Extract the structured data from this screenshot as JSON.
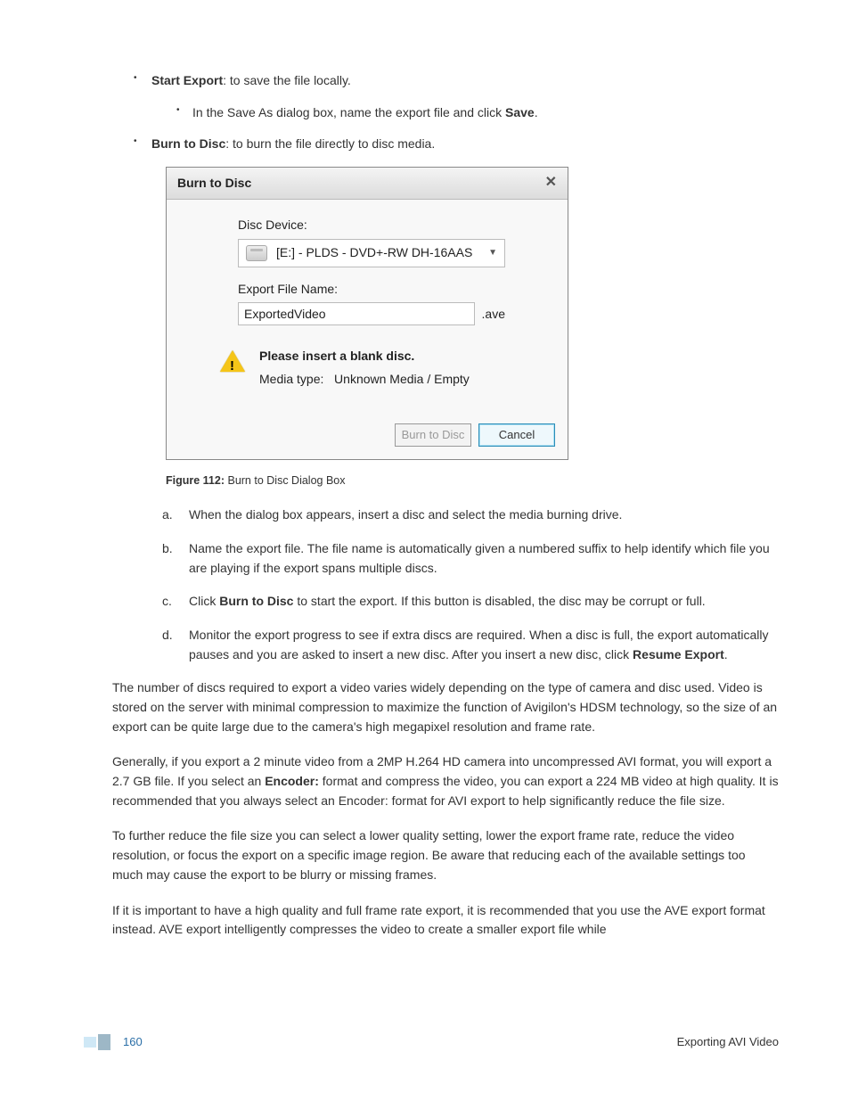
{
  "list": {
    "start_export_label": "Start Export",
    "start_export_text": ": to save the file locally.",
    "save_as_text_pre": "In the Save As dialog box, name the export file and click ",
    "save_label": "Save",
    "burn_label": "Burn to Disc",
    "burn_text": ": to burn the file directly to disc media."
  },
  "dialog": {
    "title": "Burn to Disc",
    "disc_device_label": "Disc Device:",
    "drive_value": "[E:] - PLDS - DVD+-RW DH-16AAS",
    "filename_label": "Export File Name:",
    "filename_value": "ExportedVideo",
    "filename_ext": ".ave",
    "warn_title": "Please insert a blank disc.",
    "media_type_label": "Media type:",
    "media_type_value": "Unknown Media / Empty",
    "burn_btn": "Burn to Disc",
    "cancel_btn": "Cancel"
  },
  "figure": {
    "label": "Figure 112:",
    "caption": "Burn to Disc Dialog Box"
  },
  "steps": {
    "a": {
      "m": "a.",
      "t": "When the dialog box appears, insert a disc and select the media burning drive."
    },
    "b": {
      "m": "b.",
      "t": "Name the export file. The file name is automatically given a numbered suffix to help identify which file you are playing if the export spans multiple discs."
    },
    "c": {
      "m": "c.",
      "pre": "Click ",
      "bold": "Burn to Disc",
      "post": " to start the export. If this button is disabled, the disc may be corrupt or full."
    },
    "d": {
      "m": "d.",
      "pre": "Monitor the export progress to see if extra discs are required. When a disc is full, the export automatically pauses and you are asked to insert a new disc. After you insert a new disc, click ",
      "bold": "Resume Export",
      "post": "."
    }
  },
  "para1": "The number of discs required to export a video varies widely depending on the type of camera and disc used. Video is stored on the server with minimal compression to maximize the function of Avigilon's HDSM technology, so the size of an export can be quite large due to the camera's high megapixel resolution and frame rate.",
  "para2_pre": "Generally, if you export a 2 minute video from a 2MP H.264 HD camera into uncompressed AVI format, you will export a 2.7 GB file. If you select an ",
  "para2_bold": "Encoder:",
  "para2_post": " format and compress the video, you can export a 224 MB video at high quality. It is recommended that you always select an Encoder: format for AVI export to help significantly reduce the file size.",
  "para3": "To further reduce the file size you can select a lower quality setting, lower the export frame rate, reduce the video resolution, or focus the export on a specific image region. Be aware that reducing each of the available settings too much may cause the export to be blurry or missing frames.",
  "para4": "If it is important to have a high quality and full frame rate export, it is recommended that you use the AVE export format instead. AVE export intelligently compresses the video to create a smaller export file while",
  "footer": {
    "page": "160",
    "section": "Exporting AVI Video"
  }
}
